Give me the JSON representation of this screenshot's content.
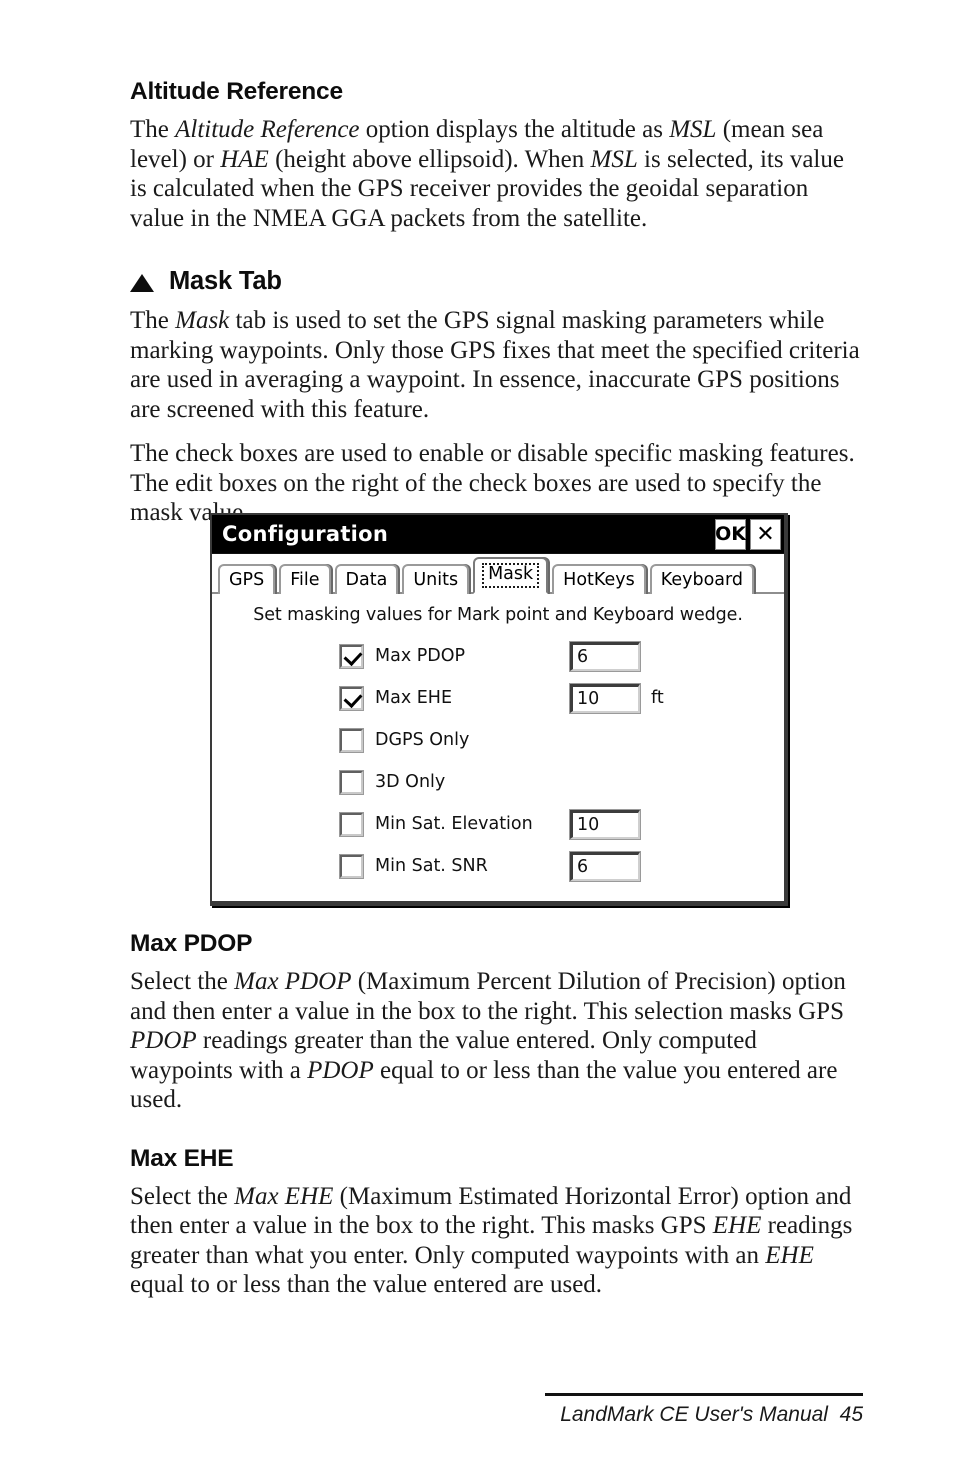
{
  "page": {
    "sections": [
      {
        "heading": "Altitude Reference",
        "bullet": false,
        "paragraphs": [
          "The <em>Altitude Reference</em> option displays the altitude as <em>MSL</em> (mean sea level) or <em>HAE</em> (height above ellipsoid). When <em>MSL</em> is selected, its value is calculated when the GPS receiver provides the geoidal separation value in the NMEA GGA packets from the satellite."
        ]
      },
      {
        "heading": "Mask Tab",
        "bullet": true,
        "bullet_glyph": "triangle-up",
        "paragraphs": [
          "The <em>Mask</em> tab is used to set the GPS signal masking parameters while marking waypoints. Only those GPS fixes that meet the specified criteria are used in averaging a waypoint. In essence, inaccurate GPS positions are screened with this feature.",
          "The check boxes are used to enable or disable specific masking features. The edit boxes on the right of the check boxes are used to specify the mask value."
        ]
      },
      {
        "heading": "Max PDOP",
        "bullet": false,
        "paragraphs": [
          "Select the <em>Max PDOP</em> (Maximum Percent Dilution of Precision) option and then enter a value in the box to the right. This selection masks GPS <em>PDOP</em> readings greater than the value entered. Only computed waypoints with a <em>PDOP</em> equal to or less than the value you entered are used."
        ]
      },
      {
        "heading": "Max EHE",
        "bullet": false,
        "paragraphs": [
          "Select the <em>Max EHE</em> (Maximum Estimated Horizontal Error) option and then enter a value in the box to the right. This masks GPS <em>EHE</em> readings greater than what you enter. Only computed waypoints with an <em>EHE</em> equal to or less than the value entered are used."
        ]
      }
    ]
  },
  "dialog": {
    "title": "Configuration",
    "titlebar_buttons": [
      {
        "name": "ok-button",
        "label": "OK"
      },
      {
        "name": "close-button",
        "label": "✕"
      }
    ],
    "tabs": [
      {
        "label": "GPS",
        "active": false
      },
      {
        "label": "File",
        "active": false
      },
      {
        "label": "Data",
        "active": false
      },
      {
        "label": "Units",
        "active": false
      },
      {
        "label": "Mask",
        "active": true
      },
      {
        "label": "HotKeys",
        "active": false
      },
      {
        "label": "Keyboard",
        "active": false
      }
    ],
    "panel_note": "Set masking values for Mark point and Keyboard wedge.",
    "rows": [
      {
        "label": "Max PDOP",
        "checked": true,
        "value": "6",
        "has_edit": true,
        "unit": ""
      },
      {
        "label": "Max EHE",
        "checked": true,
        "value": "10",
        "has_edit": true,
        "unit": "ft"
      },
      {
        "label": "DGPS Only",
        "checked": false,
        "value": "",
        "has_edit": false,
        "unit": ""
      },
      {
        "label": "3D Only",
        "checked": false,
        "value": "",
        "has_edit": false,
        "unit": ""
      },
      {
        "label": "Min Sat. Elevation",
        "checked": false,
        "value": "10",
        "has_edit": true,
        "unit": ""
      },
      {
        "label": "Min Sat. SNR",
        "checked": false,
        "value": "6",
        "has_edit": true,
        "unit": ""
      }
    ]
  },
  "footer": {
    "text": "LandMark CE User's Manual  45"
  },
  "colors": {
    "titlebar_bg": "#000000",
    "titlebar_fg": "#ffffff",
    "page_bg": "#ffffff",
    "text": "#1a1a1a",
    "dialog_border": "#3a3a3a"
  }
}
